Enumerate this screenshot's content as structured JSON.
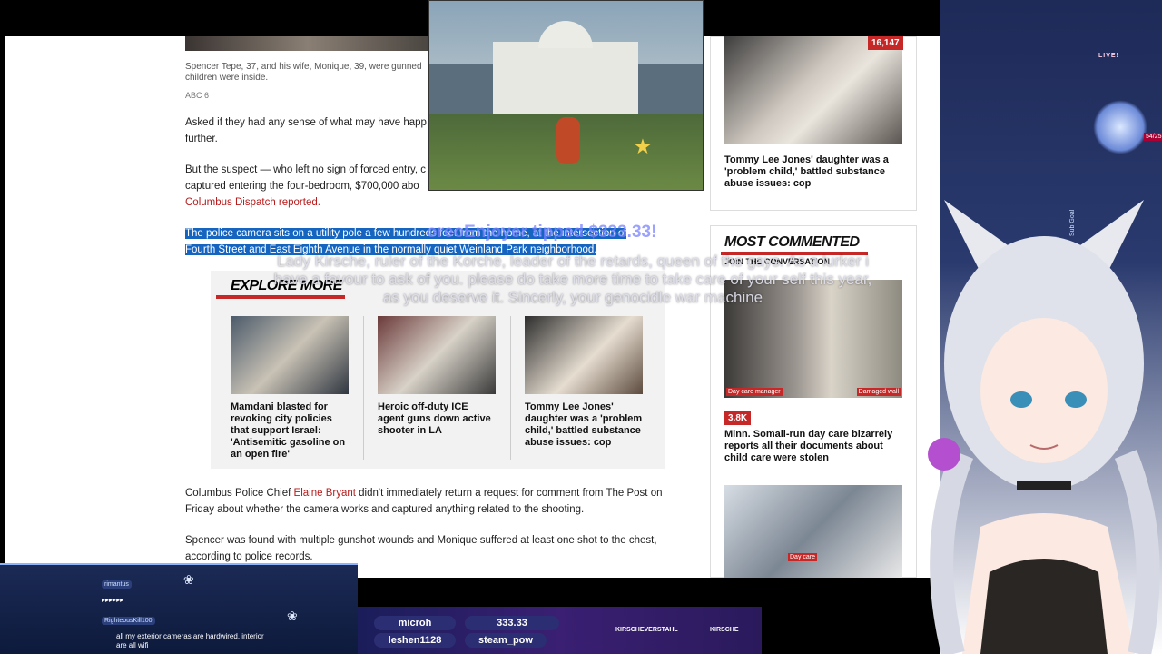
{
  "article": {
    "caption": "Spencer Tepe, 37, and his wife, Monique, 39, were gunned",
    "caption_line2": "children were inside.",
    "credit": "ABC 6",
    "para1_line1": "Asked if they had any sense of what may have happ",
    "para1_line2": "further.",
    "para2_line1": "But the suspect — who left no sign of forced entry, c",
    "para2_line2": "captured entering the four-bedroom, $700,000 abo",
    "para2_link": "Columbus Dispatch reported.",
    "para3_line1": "The police camera sits on a utility pole a few hundreds feet from the home, at the intersection of",
    "para3_line2": "Fourth Street and East Eighth Avenue in the normally quiet Weinland Park neighborhood.",
    "para4_pre": "Columbus Police Chief ",
    "para4_link": "Elaine Bryant",
    "para4_post": " didn't immediately return a request for comment from The Post on",
    "para4_line2": "Friday about whether the camera works and captured anything related to the shooting.",
    "para5_line1": "Spencer was found with multiple gunshot wounds and Monique suffered at least one shot to the chest,",
    "para5_line2": "according to police records."
  },
  "explore": {
    "title": "EXPLORE MORE",
    "cards": [
      {
        "title": "Mamdani blasted for revoking city policies that support Israel: 'Antisemitic gasoline on an open fire'"
      },
      {
        "title": "Heroic off-duty ICE agent guns down active shooter in LA"
      },
      {
        "title": "Tommy Lee Jones' daughter was a 'problem child,' battled substance abuse issues: cop"
      }
    ]
  },
  "sidebar": {
    "top_badge": "16,147",
    "top_title": "Tommy Lee Jones' daughter was a 'problem child,' battled substance abuse issues: cop",
    "most_commented": "MOST COMMENTED",
    "join": "JOIN THE CONVERSATION",
    "img_label_left": "Day care manager",
    "img_label_right": "Damaged wall",
    "mc_badge": "3.8K",
    "mc_title": "Minn. Somali-run day care bizarrely reports all their documents about child care were stolen",
    "img2_label": "Day care"
  },
  "overlay": {
    "donation_banner": "oreoEnjoyer tipped $333.33!",
    "message": "Lady Kirsche, ruler of the Korche, leader of the retards, queen of the gays. As a lurker i have a favour to ask of you. please do take more time to take care of your self this year, as you deserve it. Sincerly, your genocidle war machine"
  },
  "chat": {
    "messages": [
      {
        "user": "rimantus",
        "text": "▸▸▸▸▸▸"
      },
      {
        "user": "RighteousKill100",
        "text": "all my exterior cameras are hardwired, interior are all wifi"
      }
    ]
  },
  "bottombar": {
    "pill1": "microh",
    "pill2": "333.33",
    "pill3": "leshen1128",
    "pill4": "steam_pow",
    "social1": "KIRSCHEVERSTAHL",
    "social2": "KIRSCHE"
  },
  "stream": {
    "live_label": "LIVE!",
    "sub_counter": "54/25",
    "sub_goal": "Sub Goal"
  }
}
